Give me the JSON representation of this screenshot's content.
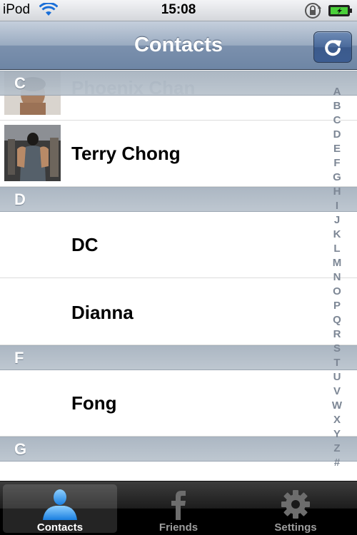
{
  "status_bar": {
    "carrier": "iPod",
    "time": "15:08"
  },
  "nav": {
    "title": "Contacts",
    "refresh_icon": "refresh-icon"
  },
  "sections": [
    {
      "letter": "C",
      "rows": [
        {
          "name": "Phoenix Chan",
          "avatar": true
        },
        {
          "name": "Terry Chong",
          "avatar": true
        }
      ]
    },
    {
      "letter": "D",
      "rows": [
        {
          "name": "DC",
          "avatar": false
        },
        {
          "name": "Dianna",
          "avatar": false
        }
      ]
    },
    {
      "letter": "F",
      "rows": [
        {
          "name": "Fong",
          "avatar": false
        }
      ]
    },
    {
      "letter": "G",
      "rows": []
    }
  ],
  "index": [
    "A",
    "B",
    "C",
    "D",
    "E",
    "F",
    "G",
    "H",
    "I",
    "J",
    "K",
    "L",
    "M",
    "N",
    "O",
    "P",
    "Q",
    "R",
    "S",
    "T",
    "U",
    "V",
    "W",
    "X",
    "Y",
    "Z",
    "#"
  ],
  "tabs": [
    {
      "label": "Contacts",
      "icon": "person-icon",
      "active": true
    },
    {
      "label": "Friends",
      "icon": "facebook-icon",
      "active": false
    },
    {
      "label": "Settings",
      "icon": "gear-icon",
      "active": false
    }
  ],
  "colors": {
    "nav_bar": "#8a9db6",
    "section_header": "#aab5c1",
    "tab_active_icon": "#2e9df0"
  }
}
